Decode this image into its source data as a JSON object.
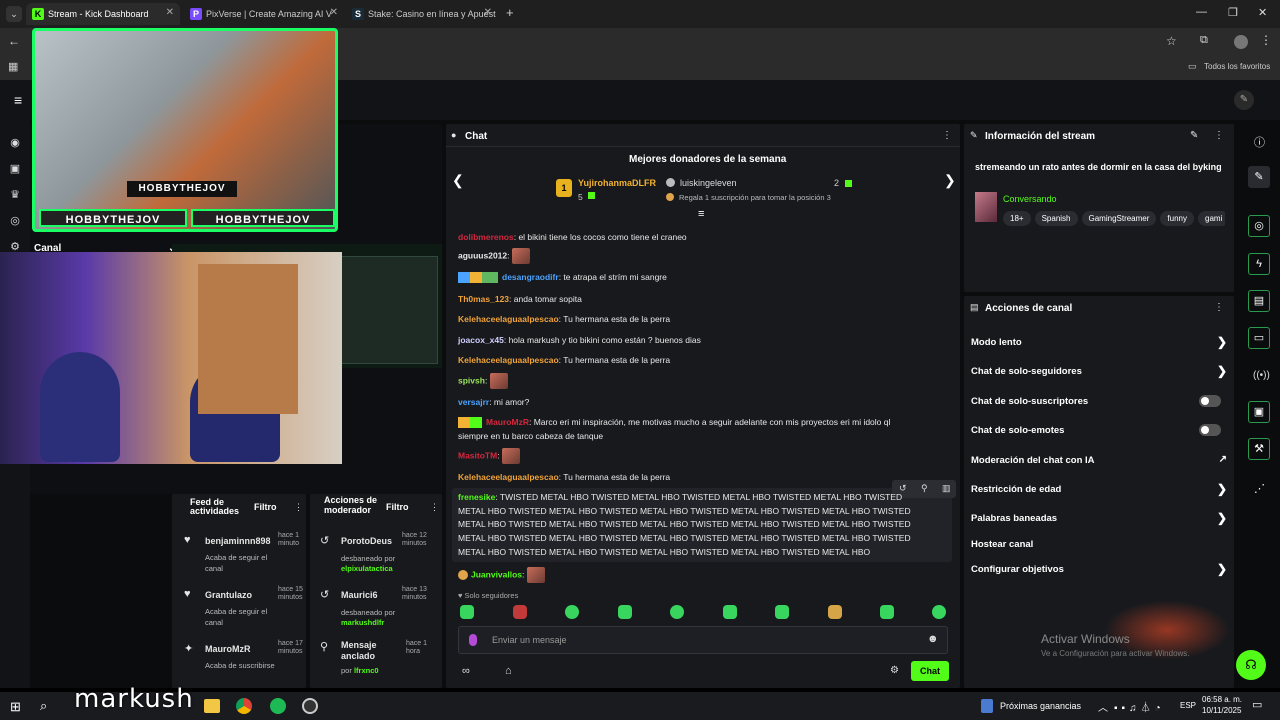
{
  "browser": {
    "tabs": [
      {
        "title": "Stream - Kick Dashboard",
        "favicon": "K"
      },
      {
        "title": "PixVerse | Create Amazing AI V",
        "favicon": "P"
      },
      {
        "title": "Stake: Casino en línea y Apuest",
        "favicon": "S"
      }
    ],
    "bookmarks_label": "Todos los favoritos"
  },
  "overlay": {
    "cam_tags": [
      "HOBBYTHEJOV",
      "HOBBYTHEJOV",
      "HOBBYTHEJOV"
    ],
    "canal_label": "Canal"
  },
  "chat": {
    "header": "Chat",
    "donors_title": "Mejores donadores de la semana",
    "donor1": {
      "rank": "1",
      "name": "YujirohanmaDLFR",
      "count": "5"
    },
    "donor2": {
      "name": "luiskingeleven",
      "count": "2"
    },
    "donor_promo": "Regala 1 suscripción para tomar la posición 3",
    "messages": [
      {
        "user": "dolibmerenos",
        "text": ": el bikini tiene los cocos como tiene el craneo",
        "color": "#d7263d"
      },
      {
        "user": "aguuus2012",
        "text": ":",
        "color": "#f0f0f0"
      },
      {
        "user": "desangraodifr",
        "text": ": te atrapa el strím mi sangre",
        "color": "#4aa3ff"
      },
      {
        "user": "Th0mas_123",
        "text": ": anda tomar sopita",
        "color": "#f2a33a"
      },
      {
        "user": "Kelehaceelaguaalpescao",
        "text": ": Tu hermana esta de la perra",
        "color": "#f2a33a"
      },
      {
        "user": "joacox_x45",
        "text": ": hola markush y tio bikini como están ? buenos dias",
        "color": "#f0f0f0"
      },
      {
        "user": "Kelehaceelaguaalpescao",
        "text": ": Tu hermana esta de la perra",
        "color": "#f2a33a"
      },
      {
        "user": "spivsh",
        "text": ":",
        "color": "#9be55a"
      },
      {
        "user": "versajrr",
        "text": ": mi amor?",
        "color": "#4aa3ff"
      },
      {
        "user": "MauroMzR",
        "text": ": Marco eri mi inspiración, me motivas mucho a seguir adelante con mis proyectos eri mi idolo ql",
        "color": "#d7263d"
      },
      {
        "user": "",
        "text": "siempre en tu barco cabeza de tanque",
        "color": "#f0f0f0"
      },
      {
        "user": "MasitoTM",
        "text": ":",
        "color": "#d7263d"
      },
      {
        "user": "Kelehaceelaguaalpescao",
        "text": ": Tu hermana esta de la perra",
        "color": "#f2a33a"
      }
    ],
    "highlighted": {
      "user": "frenesike",
      "lines": [
        ": TWISTED METAL HBO TWISTED METAL HBO TWISTED METAL HBO TWISTED METAL HBO TWISTED",
        "METAL HBO TWISTED METAL HBO TWISTED METAL HBO TWISTED METAL HBO TWISTED METAL HBO TWISTED",
        "METAL HBO TWISTED METAL HBO TWISTED METAL HBO TWISTED METAL HBO TWISTED METAL HBO TWISTED",
        "METAL HBO TWISTED METAL HBO TWISTED METAL HBO TWISTED METAL HBO TWISTED METAL HBO TWISTED",
        "METAL HBO TWISTED METAL HBO TWISTED METAL HBO TWISTED METAL HBO TWISTED METAL HBO"
      ]
    },
    "last_user": "Juanvivallos",
    "followers_only": "Solo seguidores",
    "input_placeholder": "Enviar un mensaje",
    "send_label": "Chat"
  },
  "stream_info": {
    "header": "Información del stream",
    "title": "stremeando un rato antes de dormir en la casa del byking",
    "category": "Conversando",
    "tags": [
      "18+",
      "Spanish",
      "GamingStreamer",
      "funny",
      "gami"
    ]
  },
  "channel_actions": {
    "header": "Acciones de canal",
    "items": [
      {
        "label": "Modo lento",
        "type": "chevron"
      },
      {
        "label": "Chat de solo-seguidores",
        "type": "chevron"
      },
      {
        "label": "Chat de solo-suscriptores",
        "type": "toggle"
      },
      {
        "label": "Chat de solo-emotes",
        "type": "toggle"
      },
      {
        "label": "Moderación del chat con IA",
        "type": "external"
      },
      {
        "label": "Restricción de edad",
        "type": "chevron"
      },
      {
        "label": "Palabras baneadas",
        "type": "chevron"
      },
      {
        "label": "Hostear canal",
        "type": "none"
      },
      {
        "label": "Configurar objetivos",
        "type": "chevron"
      }
    ]
  },
  "activity_feed": {
    "header": "Feed de actividades",
    "filter": "Filtro",
    "items": [
      {
        "user": "benjaminnn898",
        "time": "hace 1 minuto",
        "desc": "Acaba de seguir el canal"
      },
      {
        "user": "Grantulazo",
        "time": "hace 15 minutos",
        "desc": "Acaba de seguir el canal"
      },
      {
        "user": "MauroMzR",
        "time": "hace 17 minutos",
        "desc": "Acaba de suscribirse"
      }
    ]
  },
  "mod_actions": {
    "header": "Acciones de moderador",
    "filter": "Filtro",
    "items": [
      {
        "user": "PorotoDeus",
        "time": "hace 12 minutos",
        "desc": "desbaneado por",
        "by": "elpixulatactica"
      },
      {
        "user": "Maurici6",
        "time": "hace 13 minutos",
        "desc": "desbaneado por",
        "by": "markushdlfr"
      },
      {
        "user": "Mensaje anclado",
        "time": "hace 1 hora",
        "desc": "por",
        "by": "lfrxnc0"
      }
    ]
  },
  "watermark": {
    "line1": "Activar Windows",
    "line2": "Ve a Configuración para activar Windows."
  },
  "streamer_name": "markush",
  "taskbar": {
    "news": "Próximas ganancias",
    "lang": "ESP",
    "time": "06:58 a. m.",
    "date": "10/11/2025"
  },
  "colors": {
    "accent": "#53fc18",
    "panel": "#18191d",
    "bg": "#0b0c0e"
  }
}
